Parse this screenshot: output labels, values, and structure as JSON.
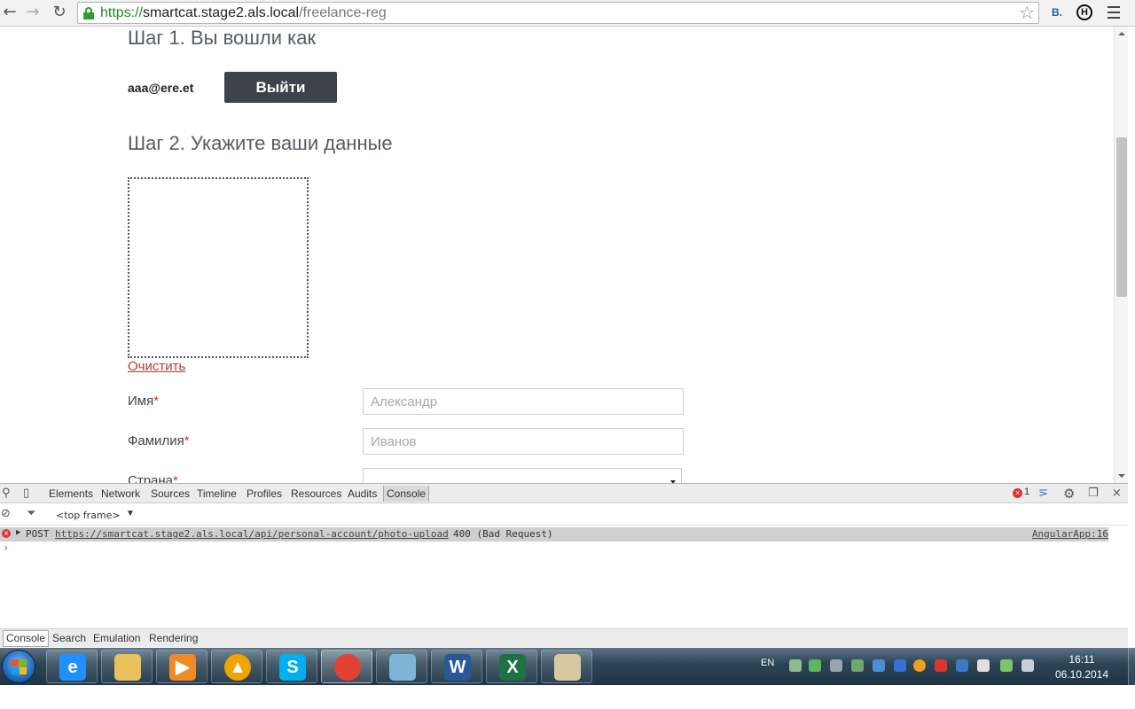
{
  "browser": {
    "url_scheme": "https://",
    "url_host": "smartcat.stage2.als.local",
    "url_path": "/freelance-reg",
    "ext_b_label": "B.",
    "ext_h_label": "H"
  },
  "page": {
    "step1_title": "Шаг 1. Вы вошли как",
    "email": "aaa@ere.et",
    "logout_label": "Выйти",
    "step2_title": "Шаг 2. Укажите ваши данные",
    "clear_label": "Очистить",
    "fields": {
      "first_name_label": "Имя",
      "first_name_placeholder": "Александр",
      "last_name_label": "Фамилия",
      "last_name_placeholder": "Иванов",
      "country_label": "Страна",
      "required_mark": "*"
    }
  },
  "devtools": {
    "tabs": [
      "Elements",
      "Network",
      "Sources",
      "Timeline",
      "Profiles",
      "Resources",
      "Audits",
      "Console"
    ],
    "active_tab": "Console",
    "error_count": "1",
    "frame_selector": "<top frame>",
    "log": {
      "method": "POST",
      "url": "https://smartcat.stage2.als.local/api/personal-account/photo-upload",
      "status": "400 (Bad Request)",
      "source": "AngularApp:16"
    },
    "prompt": "›",
    "drawer_tabs": [
      "Console",
      "Search",
      "Emulation",
      "Rendering"
    ]
  },
  "taskbar": {
    "apps": [
      {
        "name": "internet-explorer",
        "glyph": "e",
        "color": "#1e90ff"
      },
      {
        "name": "file-explorer",
        "glyph": "",
        "color": "#e8c15a"
      },
      {
        "name": "media-player",
        "glyph": "▶",
        "color": "#f08a24"
      },
      {
        "name": "aimp",
        "glyph": "▲",
        "color": "#f0a400"
      },
      {
        "name": "skype",
        "glyph": "S",
        "color": "#00aff0"
      },
      {
        "name": "chrome",
        "glyph": "",
        "color": "#e34133"
      },
      {
        "name": "notepad",
        "glyph": "",
        "color": "#7fb6d8"
      },
      {
        "name": "word",
        "glyph": "W",
        "color": "#2b5797"
      },
      {
        "name": "excel",
        "glyph": "X",
        "color": "#1e7145"
      },
      {
        "name": "paint",
        "glyph": "",
        "color": "#d8c8a0"
      }
    ],
    "language": "EN",
    "time": "16:11",
    "date": "06.10.2014"
  }
}
